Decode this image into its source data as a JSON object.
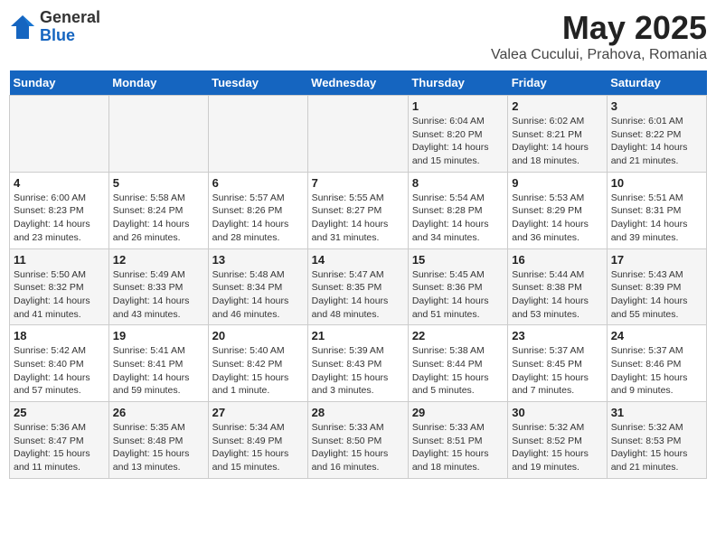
{
  "logo": {
    "general": "General",
    "blue": "Blue"
  },
  "title": {
    "month_year": "May 2025",
    "location": "Valea Cucului, Prahova, Romania"
  },
  "days_of_week": [
    "Sunday",
    "Monday",
    "Tuesday",
    "Wednesday",
    "Thursday",
    "Friday",
    "Saturday"
  ],
  "weeks": [
    [
      {
        "day": "",
        "info": ""
      },
      {
        "day": "",
        "info": ""
      },
      {
        "day": "",
        "info": ""
      },
      {
        "day": "",
        "info": ""
      },
      {
        "day": "1",
        "info": "Sunrise: 6:04 AM\nSunset: 8:20 PM\nDaylight: 14 hours\nand 15 minutes."
      },
      {
        "day": "2",
        "info": "Sunrise: 6:02 AM\nSunset: 8:21 PM\nDaylight: 14 hours\nand 18 minutes."
      },
      {
        "day": "3",
        "info": "Sunrise: 6:01 AM\nSunset: 8:22 PM\nDaylight: 14 hours\nand 21 minutes."
      }
    ],
    [
      {
        "day": "4",
        "info": "Sunrise: 6:00 AM\nSunset: 8:23 PM\nDaylight: 14 hours\nand 23 minutes."
      },
      {
        "day": "5",
        "info": "Sunrise: 5:58 AM\nSunset: 8:24 PM\nDaylight: 14 hours\nand 26 minutes."
      },
      {
        "day": "6",
        "info": "Sunrise: 5:57 AM\nSunset: 8:26 PM\nDaylight: 14 hours\nand 28 minutes."
      },
      {
        "day": "7",
        "info": "Sunrise: 5:55 AM\nSunset: 8:27 PM\nDaylight: 14 hours\nand 31 minutes."
      },
      {
        "day": "8",
        "info": "Sunrise: 5:54 AM\nSunset: 8:28 PM\nDaylight: 14 hours\nand 34 minutes."
      },
      {
        "day": "9",
        "info": "Sunrise: 5:53 AM\nSunset: 8:29 PM\nDaylight: 14 hours\nand 36 minutes."
      },
      {
        "day": "10",
        "info": "Sunrise: 5:51 AM\nSunset: 8:31 PM\nDaylight: 14 hours\nand 39 minutes."
      }
    ],
    [
      {
        "day": "11",
        "info": "Sunrise: 5:50 AM\nSunset: 8:32 PM\nDaylight: 14 hours\nand 41 minutes."
      },
      {
        "day": "12",
        "info": "Sunrise: 5:49 AM\nSunset: 8:33 PM\nDaylight: 14 hours\nand 43 minutes."
      },
      {
        "day": "13",
        "info": "Sunrise: 5:48 AM\nSunset: 8:34 PM\nDaylight: 14 hours\nand 46 minutes."
      },
      {
        "day": "14",
        "info": "Sunrise: 5:47 AM\nSunset: 8:35 PM\nDaylight: 14 hours\nand 48 minutes."
      },
      {
        "day": "15",
        "info": "Sunrise: 5:45 AM\nSunset: 8:36 PM\nDaylight: 14 hours\nand 51 minutes."
      },
      {
        "day": "16",
        "info": "Sunrise: 5:44 AM\nSunset: 8:38 PM\nDaylight: 14 hours\nand 53 minutes."
      },
      {
        "day": "17",
        "info": "Sunrise: 5:43 AM\nSunset: 8:39 PM\nDaylight: 14 hours\nand 55 minutes."
      }
    ],
    [
      {
        "day": "18",
        "info": "Sunrise: 5:42 AM\nSunset: 8:40 PM\nDaylight: 14 hours\nand 57 minutes."
      },
      {
        "day": "19",
        "info": "Sunrise: 5:41 AM\nSunset: 8:41 PM\nDaylight: 14 hours\nand 59 minutes."
      },
      {
        "day": "20",
        "info": "Sunrise: 5:40 AM\nSunset: 8:42 PM\nDaylight: 15 hours\nand 1 minute."
      },
      {
        "day": "21",
        "info": "Sunrise: 5:39 AM\nSunset: 8:43 PM\nDaylight: 15 hours\nand 3 minutes."
      },
      {
        "day": "22",
        "info": "Sunrise: 5:38 AM\nSunset: 8:44 PM\nDaylight: 15 hours\nand 5 minutes."
      },
      {
        "day": "23",
        "info": "Sunrise: 5:37 AM\nSunset: 8:45 PM\nDaylight: 15 hours\nand 7 minutes."
      },
      {
        "day": "24",
        "info": "Sunrise: 5:37 AM\nSunset: 8:46 PM\nDaylight: 15 hours\nand 9 minutes."
      }
    ],
    [
      {
        "day": "25",
        "info": "Sunrise: 5:36 AM\nSunset: 8:47 PM\nDaylight: 15 hours\nand 11 minutes."
      },
      {
        "day": "26",
        "info": "Sunrise: 5:35 AM\nSunset: 8:48 PM\nDaylight: 15 hours\nand 13 minutes."
      },
      {
        "day": "27",
        "info": "Sunrise: 5:34 AM\nSunset: 8:49 PM\nDaylight: 15 hours\nand 15 minutes."
      },
      {
        "day": "28",
        "info": "Sunrise: 5:33 AM\nSunset: 8:50 PM\nDaylight: 15 hours\nand 16 minutes."
      },
      {
        "day": "29",
        "info": "Sunrise: 5:33 AM\nSunset: 8:51 PM\nDaylight: 15 hours\nand 18 minutes."
      },
      {
        "day": "30",
        "info": "Sunrise: 5:32 AM\nSunset: 8:52 PM\nDaylight: 15 hours\nand 19 minutes."
      },
      {
        "day": "31",
        "info": "Sunrise: 5:32 AM\nSunset: 8:53 PM\nDaylight: 15 hours\nand 21 minutes."
      }
    ]
  ]
}
